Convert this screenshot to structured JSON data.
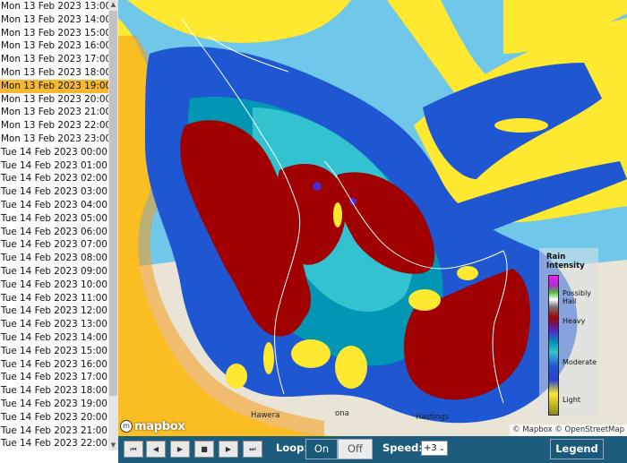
{
  "times": [
    "Mon 13 Feb 2023 13:00",
    "Mon 13 Feb 2023 14:00",
    "Mon 13 Feb 2023 15:00",
    "Mon 13 Feb 2023 16:00",
    "Mon 13 Feb 2023 17:00",
    "Mon 13 Feb 2023 18:00",
    "Mon 13 Feb 2023 19:00",
    "Mon 13 Feb 2023 20:00",
    "Mon 13 Feb 2023 21:00",
    "Mon 13 Feb 2023 22:00",
    "Mon 13 Feb 2023 23:00",
    "Tue 14 Feb 2023 00:00",
    "Tue 14 Feb 2023 01:00",
    "Tue 14 Feb 2023 02:00",
    "Tue 14 Feb 2023 03:00",
    "Tue 14 Feb 2023 04:00",
    "Tue 14 Feb 2023 05:00",
    "Tue 14 Feb 2023 06:00",
    "Tue 14 Feb 2023 07:00",
    "Tue 14 Feb 2023 08:00",
    "Tue 14 Feb 2023 09:00",
    "Tue 14 Feb 2023 10:00",
    "Tue 14 Feb 2023 11:00",
    "Tue 14 Feb 2023 12:00",
    "Tue 14 Feb 2023 13:00",
    "Tue 14 Feb 2023 14:00",
    "Tue 14 Feb 2023 15:00",
    "Tue 14 Feb 2023 16:00",
    "Tue 14 Feb 2023 17:00",
    "Tue 14 Feb 2023 18:00",
    "Tue 14 Feb 2023 19:00",
    "Tue 14 Feb 2023 20:00",
    "Tue 14 Feb 2023 21:00",
    "Tue 14 Feb 2023 22:00"
  ],
  "selected_time": "Mon 13 Feb 2023 19:00",
  "legend": {
    "title_line1": "Rain",
    "title_line2": "Intensity",
    "possibly_hail_line1": "Possibly",
    "possibly_hail_line2": "Hail",
    "heavy": "Heavy",
    "moderate": "Moderate",
    "light": "Light"
  },
  "map": {
    "logo_text": "mapbox",
    "attribution": "© Mapbox © OpenStreetMap",
    "towns": {
      "hawera": "Hawera",
      "ona": "ona",
      "hastings": "Hastings"
    }
  },
  "controls": {
    "loop_label": "Loop:",
    "loop_on": "On",
    "loop_off": "Off",
    "speed_label": "Speed:",
    "speed_value": "+3",
    "legend_button": "Legend",
    "btn_first": "⏮",
    "btn_prev": "◀",
    "btn_play": "▶",
    "btn_stop": "■",
    "btn_next": "▶",
    "btn_last": "⏭"
  },
  "colors": {
    "selected_row": "#f5b830",
    "control_bar": "#1d5c7c",
    "rain_heavy": "#a00000",
    "rain_moderate": "#1f57d2",
    "rain_light": "#ffe830",
    "sea": "#6fc7e9"
  }
}
